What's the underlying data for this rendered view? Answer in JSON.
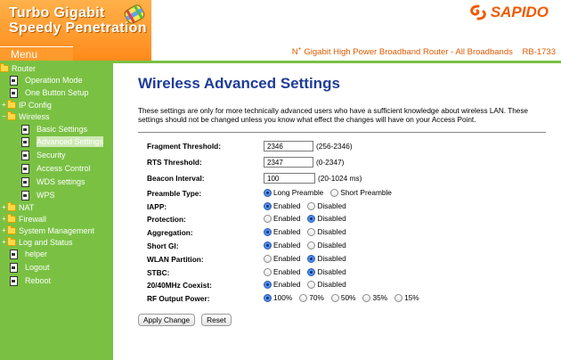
{
  "brand": {
    "title": "Turbo Gigabit\nSpeedy Penetration",
    "menu_label": "Menu"
  },
  "header": {
    "logo": "SAPIDO",
    "tagline_prefix": "N",
    "tagline_sup": "+",
    "tagline": "Gigabit High Power Broadband Router - All Broadbands",
    "model": "RB-1733"
  },
  "sidebar": {
    "router": "Router",
    "operation_mode": "Operation Mode",
    "one_button_setup": "One Button Setup",
    "ip_config": "IP Config",
    "wireless": "Wireless",
    "basic_settings": "Basic Settings",
    "advanced_settings": "Advanced Settings",
    "security": "Security",
    "access_control": "Access Control",
    "wds_settings": "WDS settings",
    "wps": "WPS",
    "nat": "NAT",
    "firewall": "Firewall",
    "system_management": "System Management",
    "log_and_status": "Log and Status",
    "helper": "helper",
    "logout": "Logout",
    "reboot": "Reboot"
  },
  "main": {
    "title": "Wireless Advanced Settings",
    "description": "These settings are only for more technically advanced users who have a sufficient knowledge about wireless LAN. These settings should not be changed unless you know what effect the changes will have on your Access Point."
  },
  "form": {
    "fragment": {
      "label": "Fragment Threshold:",
      "value": "2346",
      "hint": "(256-2346)"
    },
    "rts": {
      "label": "RTS Threshold:",
      "value": "2347",
      "hint": "(0-2347)"
    },
    "beacon": {
      "label": "Beacon Interval:",
      "value": "100",
      "hint": "(20-1024 ms)"
    },
    "preamble": {
      "label": "Preamble Type:",
      "opt1": "Long Preamble",
      "opt2": "Short Preamble"
    },
    "iapp": {
      "label": "IAPP:",
      "opt1": "Enabled",
      "opt2": "Disabled"
    },
    "protection": {
      "label": "Protection:",
      "opt1": "Enabled",
      "opt2": "Disabled"
    },
    "aggregation": {
      "label": "Aggregation:",
      "opt1": "Enabled",
      "opt2": "Disabled"
    },
    "short_gi": {
      "label": "Short GI:",
      "opt1": "Enabled",
      "opt2": "Disabled"
    },
    "wlan_partition": {
      "label": "WLAN Partition:",
      "opt1": "Enabled",
      "opt2": "Disabled"
    },
    "stbc": {
      "label": "STBC:",
      "opt1": "Enabled",
      "opt2": "Disabled"
    },
    "coexist": {
      "label": "20/40MHz Coexist:",
      "opt1": "Enabled",
      "opt2": "Disabled"
    },
    "rf_power": {
      "label": "RF Output Power:",
      "opt1": "100%",
      "opt2": "70%",
      "opt3": "50%",
      "opt4": "35%",
      "opt5": "15%"
    }
  },
  "buttons": {
    "apply": "Apply Change",
    "reset": "Reset"
  }
}
